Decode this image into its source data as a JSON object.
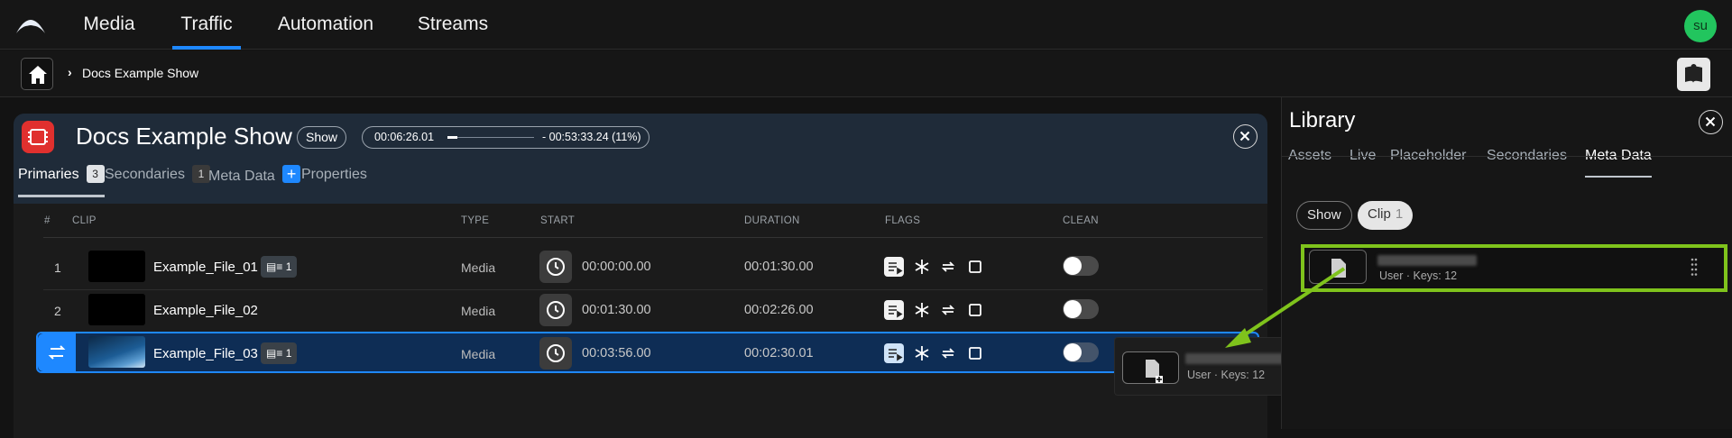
{
  "nav": {
    "tabs": [
      {
        "label": "Media",
        "active": false
      },
      {
        "label": "Traffic",
        "active": true
      },
      {
        "label": "Automation",
        "active": false
      },
      {
        "label": "Streams",
        "active": false
      }
    ],
    "user_initials": "su",
    "accent_color": "#1e88ff",
    "avatar_color": "#22c55e"
  },
  "breadcrumb": {
    "home_icon": "home-icon",
    "current": "Docs Example Show"
  },
  "show": {
    "title": "Docs Example Show",
    "badge": "Show",
    "time_start": "00:06:26.01",
    "time_end": "- 00:53:33.24 (11%)",
    "progress": 0.11,
    "tabs": [
      {
        "label": "Primaries",
        "count": "3"
      },
      {
        "label": "Secondaries",
        "count": "1"
      },
      {
        "label": "Meta Data",
        "count": "+"
      },
      {
        "label": "Properties",
        "count": ""
      }
    ],
    "columns": [
      "#",
      "CLIP",
      "TYPE",
      "START",
      "DURATION",
      "FLAGS",
      "CLEAN"
    ],
    "rows": [
      {
        "num": "1",
        "name": "Example_File_01",
        "meta_count": "1",
        "type": "Media",
        "start": "00:00:00.00",
        "duration": "00:01:30.00",
        "clean": false
      },
      {
        "num": "2",
        "name": "Example_File_02",
        "meta_count": "",
        "type": "Media",
        "start": "00:01:30.00",
        "duration": "00:02:26.00",
        "clean": false
      },
      {
        "num": "",
        "name": "Example_File_03",
        "meta_count": "1",
        "type": "Media",
        "start": "00:03:56.00",
        "duration": "00:02:30.01",
        "clean": false,
        "selected": true
      }
    ]
  },
  "library": {
    "title": "Library",
    "tabs": [
      "Assets",
      "Live",
      "Placeholder",
      "Secondaries",
      "Meta Data"
    ],
    "active_tab": "Meta Data",
    "filters": [
      {
        "label": "Show",
        "count": ""
      },
      {
        "label": "Clip",
        "count": "1"
      }
    ],
    "item": {
      "subtext": "User · Keys: 12",
      "highlight_color": "#7fc31c"
    }
  },
  "drag_ghost": {
    "subtext": "User · Keys: 12"
  }
}
